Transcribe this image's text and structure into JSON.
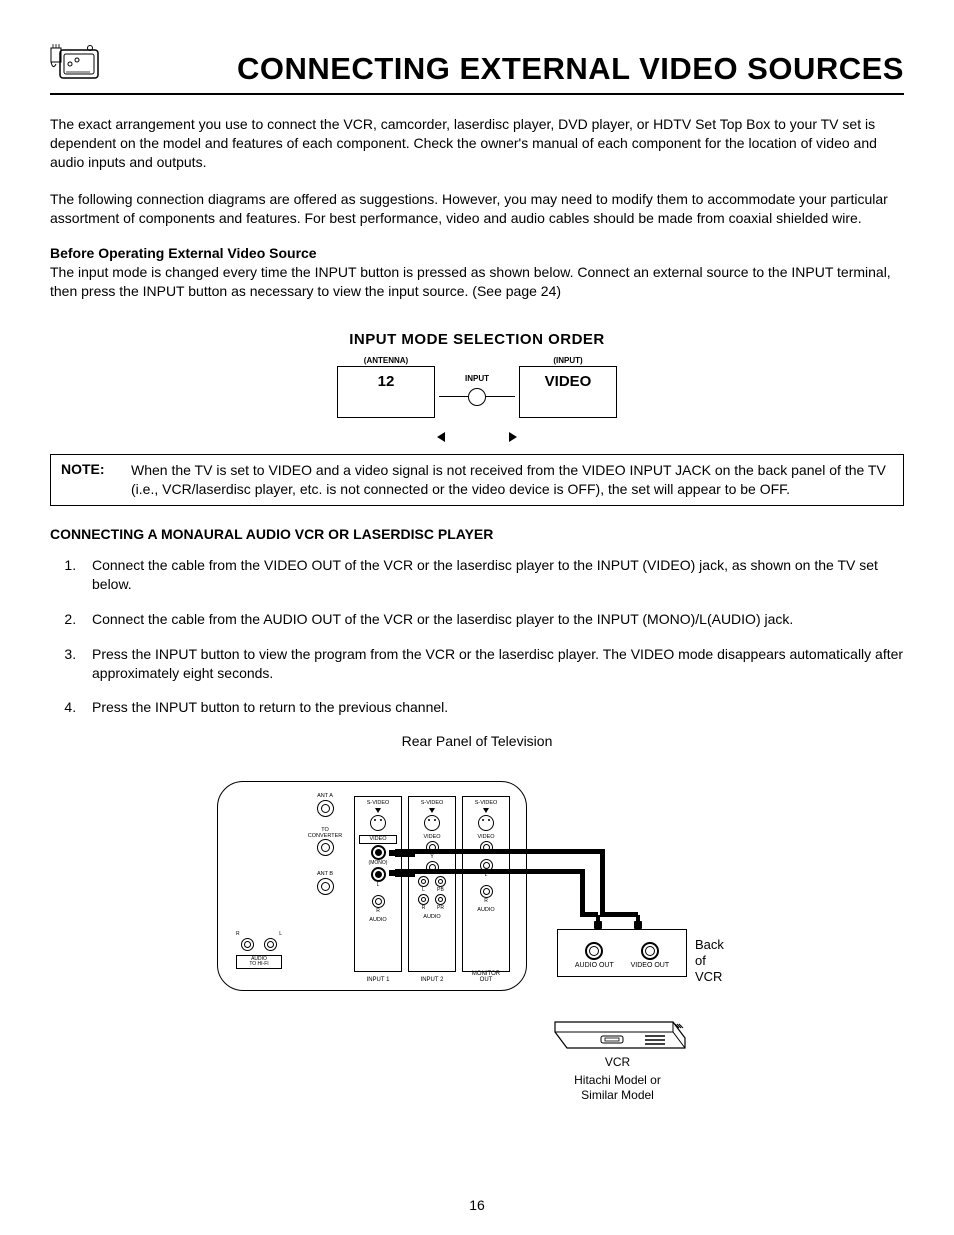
{
  "header": {
    "title": "CONNECTING EXTERNAL VIDEO SOURCES"
  },
  "paragraphs": {
    "p1": "The exact arrangement you use to connect the VCR, camcorder, laserdisc player, DVD player, or HDTV Set Top Box to your TV set is dependent on the model and features of each component.  Check the owner's manual of each component for the location of video and audio inputs and outputs.",
    "p2": "The following connection diagrams are offered as suggestions.  However, you may need to modify them to accommodate your particular assortment of components and features.  For best performance, video and audio cables should be made from coaxial shielded wire.",
    "before_heading": "Before Operating External Video Source",
    "p3": "The input mode is changed every time the INPUT button is pressed as shown below.  Connect an external source to the INPUT terminal, then press the INPUT button as necessary to view the input source.  (See page 24)"
  },
  "input_mode": {
    "title": "INPUT MODE SELECTION ORDER",
    "left_small": "(ANTENNA)",
    "right_small": "(INPUT)",
    "left_box": "12",
    "right_box": "VIDEO",
    "button_label": "INPUT"
  },
  "note": {
    "label": "NOTE:",
    "text": "When the TV is set to VIDEO and a video signal is not received from the VIDEO INPUT JACK on the back panel of the TV (i.e., VCR/laserdisc player, etc. is not connected or the video device is OFF), the set will appear to be OFF."
  },
  "connecting": {
    "heading": "CONNECTING A MONAURAL AUDIO VCR OR LASERDISC PLAYER",
    "steps": [
      "Connect the cable from the VIDEO OUT of the VCR or the laserdisc player to the INPUT (VIDEO) jack, as shown on the TV set below.",
      "Connect the cable from the AUDIO OUT of the VCR or the laserdisc player to the INPUT (MONO)/L(AUDIO) jack.",
      "Press the INPUT button to view the program from the VCR or the laserdisc player.  The VIDEO mode disappears automatically after approximately eight seconds.",
      "Press the INPUT button to return to the previous channel."
    ]
  },
  "figure": {
    "title": "Rear Panel of Television",
    "tv_labels": {
      "ant_a": "ANT A",
      "to_conv": "TO\nCONVERTER",
      "ant_b": "ANT B",
      "svideo": "S-VIDEO",
      "video": "VIDEO",
      "mono": "(MONO)",
      "l": "L",
      "r": "R",
      "audio": "AUDIO",
      "input1": "INPUT 1",
      "input2": "INPUT 2",
      "monitor_out": "MONITOR\nOUT",
      "y": "Y",
      "pb": "PB",
      "pr": "PR",
      "audio_hifi": "AUDIO\nTO HI-FI"
    },
    "vcr_back": {
      "audio_out": "AUDIO OUT",
      "video_out": "VIDEO OUT",
      "back_of": "Back of\nVCR"
    },
    "vcr_label": "VCR",
    "hitachi": "Hitachi Model or\nSimilar Model"
  },
  "page_number": "16"
}
